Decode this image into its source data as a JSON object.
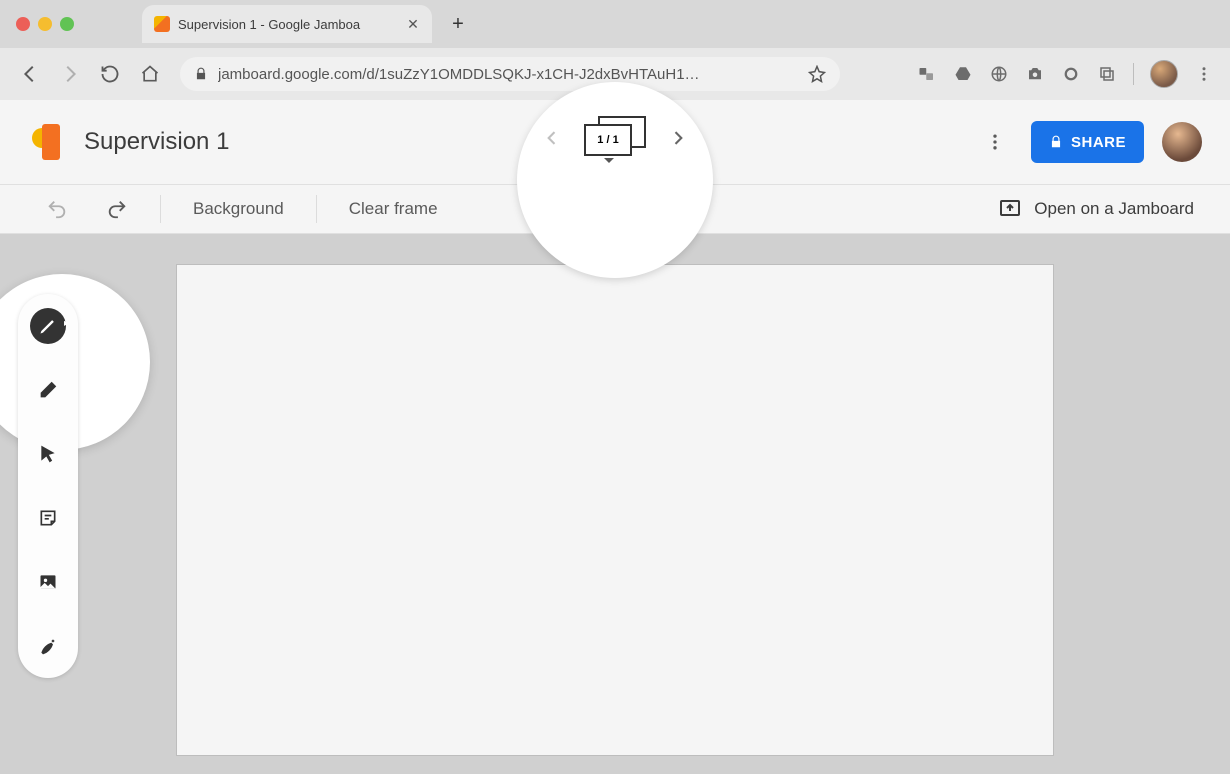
{
  "browser": {
    "tab_title": "Supervision 1 - Google Jamboa",
    "url": "jamboard.google.com/d/1suZzY1OMDDLSQKJ-x1CH-J2dxBvHTAuH1…"
  },
  "app": {
    "document_title": "Supervision 1",
    "share_label": "SHARE",
    "frame_indicator": "1 / 1",
    "background_label": "Background",
    "clear_frame_label": "Clear frame",
    "open_on_jamboard_label": "Open on a Jamboard"
  }
}
